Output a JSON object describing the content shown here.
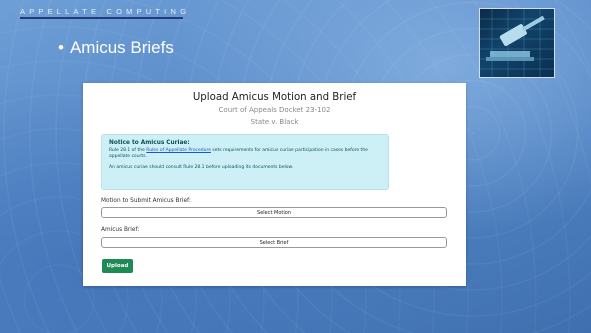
{
  "slide": {
    "brand": "APPELLATE COMPUTING",
    "bullet": "•",
    "title": "Amicus Briefs",
    "thumbnail_icon": "gavel-icon"
  },
  "form": {
    "title": "Upload Amicus Motion and Brief",
    "court": "Court of Appeals Docket 23-102",
    "case": "State v. Black",
    "notice": {
      "title": "Notice to Amicus Curiae:",
      "line1_prefix": "Rule 28.1 of the ",
      "line1_link": "Rules of Appellate Procedure",
      "line1_suffix": " sets requirements for amicus curiae participation in cases before the",
      "line2": "appellate courts.",
      "line3": "An amicus curiae should consult Rule 28.1 before uploading its documents below."
    },
    "motion_label": "Motion to Submit Amicus Brief:",
    "motion_button": "Select Motion",
    "brief_label": "Amicus Brief:",
    "brief_button": "Select Brief",
    "upload_button": "Upload"
  },
  "colors": {
    "upload": "#1e8a54",
    "notice_bg": "#cdf0f6",
    "slide_bg": "#5a8bc9"
  }
}
